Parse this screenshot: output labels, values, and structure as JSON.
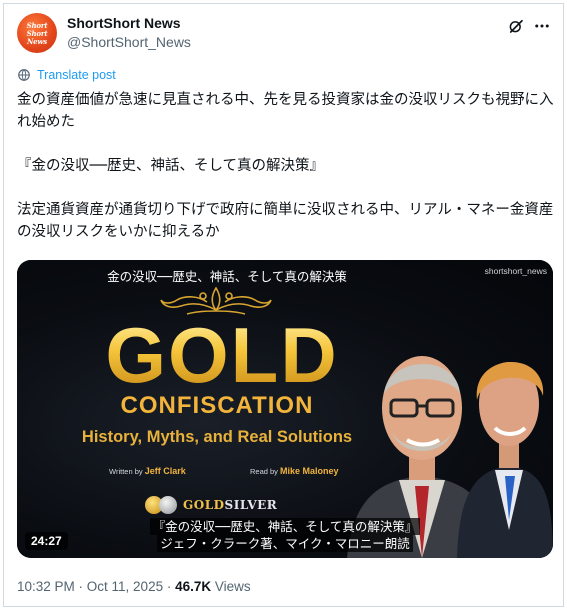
{
  "account": {
    "display_name": "ShortShort News",
    "handle": "@ShortShort_News",
    "avatar_lines": [
      "Short",
      "Short",
      "News"
    ]
  },
  "actions": {
    "grok_icon": "grok-icon",
    "more_icon": "more-icon"
  },
  "translate": {
    "label": "Translate post"
  },
  "post": {
    "paragraph1": "金の資産価値が急速に見直される中、先を見る投資家は金の没収リスクも視野に入れ始めた",
    "paragraph2": "『金の没収──歴史、神話、そして真の解決策』",
    "paragraph3": "法定通貨資産が通貨切り下げで政府に簡単に没収される中、リアル・マネー金資産の没収リスクをいかに抑えるか"
  },
  "video": {
    "top_title": "金の没収──歴史、神話、そして真の解決策",
    "watermark": "shortshort_news",
    "title_big": "GOLD",
    "title_sub": "CONFISCATION",
    "subtitle": "History, Myths, and Real Solutions",
    "written_by_label": "Written by",
    "written_by_name": "Jeff Clark",
    "read_by_label": "Read by",
    "read_by_name": "Mike Maloney",
    "brand_gold": "GOLD",
    "brand_silver": "SILVER",
    "caption_line1": "『金の没収──歴史、神話、そして真の解決策』",
    "caption_line2": "ジェフ・クラーク著、マイク・マロニー朗読",
    "duration": "24:27"
  },
  "meta": {
    "time": "10:32 PM · Oct 11, 2025 · ",
    "views_count": "46.7K",
    "views_label": " Views"
  },
  "colors": {
    "link": "#1d9bf0",
    "gold": "#f2b43b",
    "muted": "#536471"
  }
}
